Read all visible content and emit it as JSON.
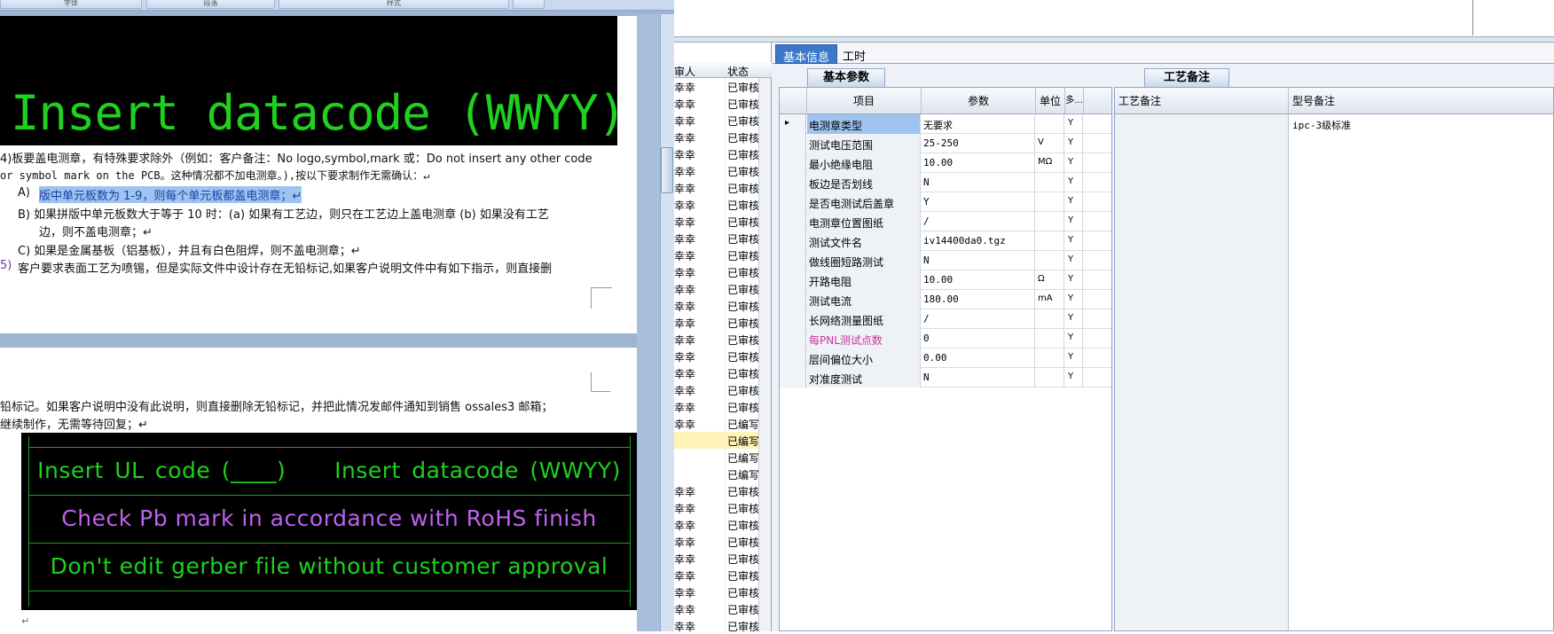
{
  "word": {
    "ribbon_groups": [
      "字体",
      "段落",
      "样式"
    ],
    "page1": {
      "image_text": "Insert datacode (WWYY)",
      "lines": [
        "4)板要盖电测章，有特殊要求除外（例如：客户备注：No logo,symbol,mark 或：Do not insert any other code",
        "or symbol mark on the PCB。这种情况都不加电测章。),按以下要求制作无需确认：↵",
        "A)",
        "版中单元板数为 1-9，则每个单元板都盖电测章；↵",
        "B)  如果拼版中单元板数大于等于 10 时：(a) 如果有工艺边，则只在工艺边上盖电测章 (b) 如果没有工艺",
        "边，则不盖电测章；↵",
        "C)  如果是金属基板（铝基板），并且有白色阻焊，则不盖电测章；↵",
        "5)",
        "客户要求表面工艺为喷锡，但是实际文件中设计存在无铅标记,如果客户说明文件中有如下指示，则直接删"
      ]
    },
    "page2": {
      "lines": [
        "铅标记。如果客户说明中没有此说明，则直接删除无铅标记，并把此情况发邮件通知到销售 ossales3 邮箱；",
        "继续制作，无需等待回复；↵"
      ],
      "gerber": {
        "row1_left": "Insert UL code (____)",
        "row1_right": "Insert datacode (WWYY)",
        "row2": "Check Pb mark in accordance with RoHS finish",
        "row3": "Don't edit gerber file without customer approval"
      },
      "return_mark": "↵"
    }
  },
  "list_panel": {
    "headers": [
      "审人",
      "状态"
    ],
    "rows": [
      [
        "幸幸",
        "已审核"
      ],
      [
        "幸幸",
        "已审核"
      ],
      [
        "幸幸",
        "已审核"
      ],
      [
        "幸幸",
        "已审核"
      ],
      [
        "幸幸",
        "已审核"
      ],
      [
        "幸幸",
        "已审核"
      ],
      [
        "幸幸",
        "已审核"
      ],
      [
        "幸幸",
        "已审核"
      ],
      [
        "幸幸",
        "已审核"
      ],
      [
        "幸幸",
        "已审核"
      ],
      [
        "幸幸",
        "已审核"
      ],
      [
        "幸幸",
        "已审核"
      ],
      [
        "幸幸",
        "已审核"
      ],
      [
        "幸幸",
        "已审核"
      ],
      [
        "幸幸",
        "已审核"
      ],
      [
        "幸幸",
        "已审核"
      ],
      [
        "幸幸",
        "已审核"
      ],
      [
        "幸幸",
        "已审核"
      ],
      [
        "幸幸",
        "已审核"
      ],
      [
        "幸幸",
        "已审核"
      ],
      [
        "幸幸",
        "已编写"
      ],
      [
        "",
        "已编写"
      ],
      [
        "",
        "已编写"
      ],
      [
        "",
        "已编写"
      ],
      [
        "幸幸",
        "已审核"
      ],
      [
        "幸幸",
        "已审核"
      ],
      [
        "幸幸",
        "已审核"
      ],
      [
        "幸幸",
        "已审核"
      ],
      [
        "幸幸",
        "已审核"
      ],
      [
        "幸幸",
        "已审核"
      ],
      [
        "幸幸",
        "已审核"
      ],
      [
        "幸幸",
        "已审核"
      ],
      [
        "幸幸",
        "已审核"
      ]
    ]
  },
  "main": {
    "tabs": [
      "基本信息",
      "工时"
    ],
    "left_subtab": "基本参数",
    "right_subtab": "工艺备注",
    "grid_headers": {
      "item": "项目",
      "param": "参数",
      "unit": "单位",
      "flag": "多..."
    },
    "grid_rows": [
      {
        "item": "电测章类型",
        "param": "无要求",
        "unit": "",
        "flag": "Y"
      },
      {
        "item": "测试电压范围",
        "param": "25-250",
        "unit": "V",
        "flag": "Y"
      },
      {
        "item": "最小绝缘电阻",
        "param": "10.00",
        "unit": "MΩ",
        "flag": "Y"
      },
      {
        "item": "板边是否划线",
        "param": "N",
        "unit": "",
        "flag": "Y"
      },
      {
        "item": "是否电测试后盖章",
        "param": "Y",
        "unit": "",
        "flag": "Y"
      },
      {
        "item": "电测章位置图纸",
        "param": "/",
        "unit": "",
        "flag": "Y"
      },
      {
        "item": "测试文件名",
        "param": "iv14400da0.tgz",
        "unit": "",
        "flag": "Y"
      },
      {
        "item": "做线圈短路测试",
        "param": "N",
        "unit": "",
        "flag": "Y"
      },
      {
        "item": "开路电阻",
        "param": "10.00",
        "unit": "Ω",
        "flag": "Y"
      },
      {
        "item": "测试电流",
        "param": "180.00",
        "unit": "mA",
        "flag": "Y"
      },
      {
        "item": "长网络测量图纸",
        "param": "/",
        "unit": "",
        "flag": "Y"
      },
      {
        "item": "每PNL测试点数",
        "param": "0",
        "unit": "",
        "flag": "Y"
      },
      {
        "item": "层间偏位大小",
        "param": "0.00",
        "unit": "",
        "flag": "Y"
      },
      {
        "item": "对准度测试",
        "param": "N",
        "unit": "",
        "flag": "Y"
      }
    ],
    "remarks_headers": {
      "process": "工艺备注",
      "model": "型号备注"
    },
    "model_remark": "ipc-3级标准"
  },
  "colors": {
    "accent_tab": "#3b78c8",
    "green_text": "#1fd01f",
    "purple_text": "#c060f0",
    "highlight_row_item": "#cc3399"
  }
}
